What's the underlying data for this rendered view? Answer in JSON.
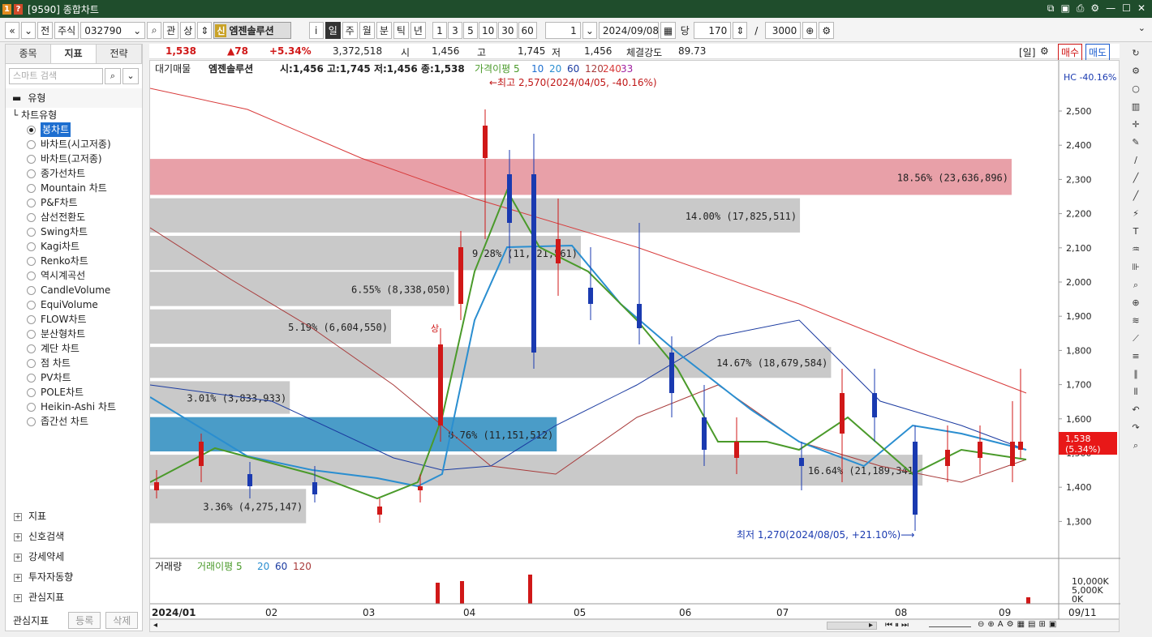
{
  "window": {
    "title": "[9590] 종합차트",
    "icons": [
      "app-icon",
      "help-icon"
    ],
    "controls": [
      "restore-icon",
      "copy-icon",
      "print-icon",
      "settings-icon",
      "minimize-icon",
      "maximize-icon",
      "close-icon"
    ]
  },
  "toolbar": {
    "nav_prev": "«",
    "nav_down": "»",
    "jeon": "전",
    "market": "주식",
    "code": "032790",
    "gwan": "관",
    "sang": "상",
    "stock_badge": "신",
    "stock_name": "엠젠솔루션",
    "info": "i",
    "periods": [
      "일",
      "주",
      "월",
      "분",
      "틱",
      "년"
    ],
    "selected_period": "일",
    "intervals": [
      "1",
      "3",
      "5",
      "10",
      "30",
      "60"
    ],
    "unit_value": "1",
    "date": "2024/09/08",
    "dang": "당",
    "count": "170",
    "slash": "/",
    "total": "3000"
  },
  "sidebar": {
    "tabs": [
      "종목",
      "지표",
      "전략"
    ],
    "active_tab": "지표",
    "search_placeholder": "스마트 검색",
    "section": "유형",
    "tree_head": "차트유형",
    "chart_types": [
      "봉차트",
      "바차트(시고저종)",
      "바차트(고저종)",
      "종가선차트",
      "Mountain 차트",
      "P&F차트",
      "삼선전환도",
      "Swing차트",
      "Kagi차트",
      "Renko차트",
      "역시계곡선",
      "CandleVolume",
      "EquiVolume",
      "FLOW차트",
      "분산형차트",
      "계단 차트",
      "점 차트",
      "PV차트",
      "POLE차트",
      "Heikin-Ashi 차트",
      "좁간선 차트"
    ],
    "selected": "봉차트",
    "groups": [
      "지표",
      "신호검색",
      "강세약세",
      "투자자동향",
      "관심지표"
    ],
    "fav_label": "관심지표",
    "register": "등록",
    "delete": "삭제"
  },
  "quote": {
    "price": "1,538",
    "change": "▲78",
    "rate": "+5.34%",
    "volume": "3,372,518",
    "open_label": "시",
    "open": "1,456",
    "high_label": "고",
    "high": "1,745",
    "low_label": "저",
    "low": "1,456",
    "strength_label": "체결강도",
    "strength": "89.73",
    "period_tag": "[일]",
    "buy": "매수",
    "sell": "매도"
  },
  "legend": {
    "main": "대기매물",
    "name": "엠젠솔루션",
    "ohlc": "시:1,456 고:1,745 저:1,456 종:1,538",
    "ma_title": "가격이평 5",
    "ma": [
      "10",
      "20",
      "60",
      "120",
      "240",
      "33"
    ],
    "hc": "HC -40.16%",
    "max_note": "←최고 2,570(2024/04/05, -40.16%)",
    "min_note": "최저 1,270(2024/08/05, +21.10%)⟶",
    "cur_price": "1,538",
    "cur_rate": "(5.34%)",
    "vol_title": "거래량",
    "vol_ma_title": "거래이평 5",
    "vol_ma": [
      "20",
      "60",
      "120"
    ],
    "signal": "상"
  },
  "chart_data": {
    "type": "candlestick",
    "y_axis": [
      "2,500",
      "2,400",
      "2,300",
      "2,200",
      "2,100",
      "2,000",
      "1,900",
      "1,800",
      "1,700",
      "1,600",
      "1,500",
      "1,400",
      "1,300"
    ],
    "y_values": [
      2500,
      2400,
      2300,
      2200,
      2100,
      2000,
      1900,
      1800,
      1700,
      1600,
      1500,
      1400,
      1300
    ],
    "x_axis": [
      "2024/01",
      "02",
      "03",
      "04",
      "05",
      "06",
      "07",
      "08",
      "09",
      "09/11"
    ],
    "vol_axis": [
      "10,000K",
      "5,000K",
      "0K"
    ],
    "volume_profile": [
      {
        "label": "18.56% (23,636,896)",
        "low": 2250,
        "high": 2360,
        "color": "#e8a0a8"
      },
      {
        "label": "14.00% (17,825,511)",
        "low": 2140,
        "high": 2245,
        "color": "#c9c9c9"
      },
      {
        "label": "9.28% (11,821,561)",
        "low": 2030,
        "high": 2135,
        "color": "#c9c9c9"
      },
      {
        "label": "6.55% (8,338,050)",
        "low": 1925,
        "high": 2030,
        "color": "#c9c9c9"
      },
      {
        "label": "5.19% (6,604,550)",
        "low": 1815,
        "high": 1920,
        "color": "#c9c9c9"
      },
      {
        "label": "14.67% (18,679,584)",
        "low": 1715,
        "high": 1810,
        "color": "#c9c9c9"
      },
      {
        "label": "3.01% (3,833,933)",
        "low": 1610,
        "high": 1710,
        "color": "#c9c9c9"
      },
      {
        "label": "8.76% (11,151,512)",
        "low": 1500,
        "high": 1605,
        "color": "#4a9cc8"
      },
      {
        "label": "16.64% (21,189,341)",
        "low": 1400,
        "high": 1495,
        "color": "#c9c9c9"
      },
      {
        "label": "3.36% (4,275,147)",
        "low": 1290,
        "high": 1395,
        "color": "#c9c9c9"
      }
    ]
  },
  "statusbar": {
    "scroll_left": "◂",
    "scroll_right": "▸"
  }
}
